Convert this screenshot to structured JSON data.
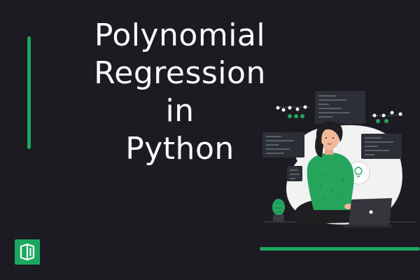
{
  "title": {
    "line1": "Polynomial",
    "line2": "Regression",
    "line3": "in",
    "line4": "Python"
  },
  "colors": {
    "background": "#1c1b22",
    "accent": "#1aa85f",
    "title_text": "#ffffff",
    "shirt": "#25a45c",
    "hair": "#1f1f22",
    "blob": "#f2f2f2",
    "code_panel": "#2c3036"
  },
  "icons": {
    "logo": "brand-logo-icon",
    "laptop": "laptop-icon",
    "plant": "cactus-icon",
    "idea": "lightbulb-icon"
  }
}
